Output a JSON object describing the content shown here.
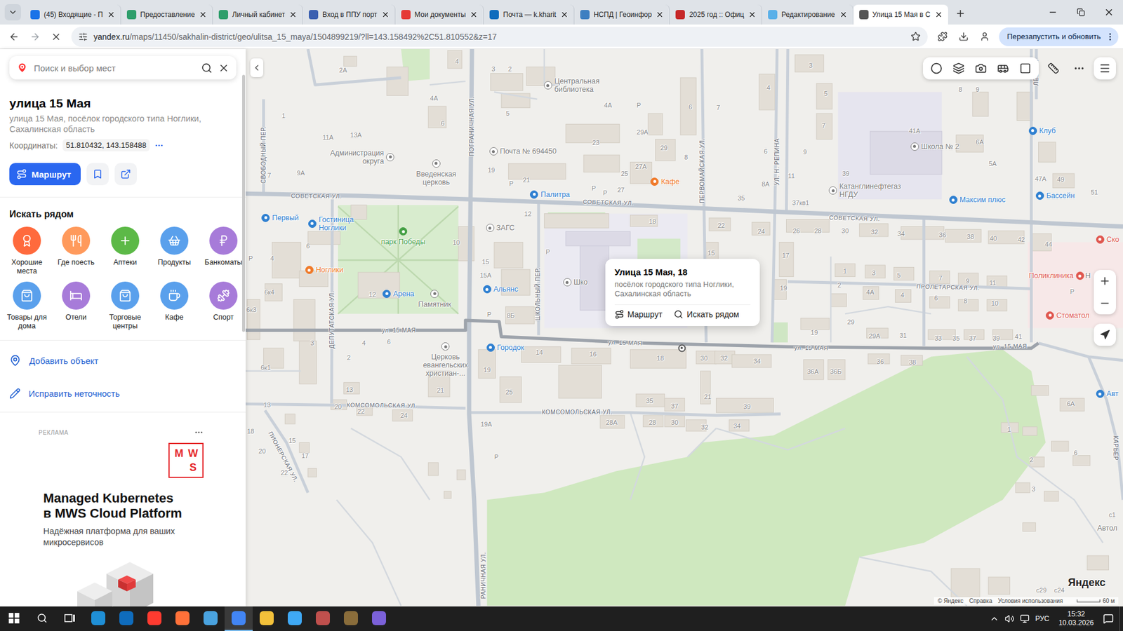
{
  "browser": {
    "tabs": [
      {
        "label": "(45) Входящие - П",
        "selected": false,
        "color": "#1a73e8"
      },
      {
        "label": "Предоставление",
        "selected": false,
        "color": "#2e9e6b"
      },
      {
        "label": "Личный кабинет",
        "selected": false,
        "color": "#2e9e6b"
      },
      {
        "label": "Вход в ППУ порт",
        "selected": false,
        "color": "#3a5fb0"
      },
      {
        "label": "Мои документы",
        "selected": false,
        "color": "#e53935"
      },
      {
        "label": "Почта — k.kharit",
        "selected": false,
        "color": "#0f6cbd"
      },
      {
        "label": "НСПД | Геоинфор",
        "selected": false,
        "color": "#3d7fc1"
      },
      {
        "label": "2025 год :: Офиц",
        "selected": false,
        "color": "#c62828"
      },
      {
        "label": "Редактирование",
        "selected": false,
        "color": "#5ab0e8"
      },
      {
        "label": "Улица 15 Мая в С",
        "selected": true,
        "color": "#555555"
      }
    ],
    "address": {
      "host": "yandex.ru",
      "path": "/maps/11450/sakhalin-district/geo/ulitsa_15_maya/1504899219/?ll=143.158492%2C51.810552&z=17",
      "bookmarked": false
    },
    "loading": true,
    "update_button": "Перезапустить и обновить"
  },
  "sidebar": {
    "search_placeholder": "Поиск и выбор мест",
    "title": "улица 15 Мая",
    "address": "улица 15 Мая, посёлок городского типа Ноглики, Сахалинская область",
    "coordinates_label": "Координаты:",
    "coordinates": "51.810432, 143.158488",
    "route_button": "Маршрут",
    "nearby_title": "Искать рядом",
    "categories": [
      {
        "label": "Хорошие места",
        "color": "#ff6a3d"
      },
      {
        "label": "Где поесть",
        "color": "#ff9a5c"
      },
      {
        "label": "Аптеки",
        "color": "#5cb947"
      },
      {
        "label": "Продукты",
        "color": "#5aa0ec"
      },
      {
        "label": "Банкоматы",
        "color": "#a77bd9"
      },
      {
        "label": "Товары для дома",
        "color": "#5aa0ec"
      },
      {
        "label": "Отели",
        "color": "#a77bd9"
      },
      {
        "label": "Торговые центры",
        "color": "#5aa0ec"
      },
      {
        "label": "Кафе",
        "color": "#5aa0ec"
      },
      {
        "label": "Спорт",
        "color": "#a77bd9"
      }
    ],
    "actions": [
      {
        "label": "Добавить объект"
      },
      {
        "label": "Исправить неточность"
      }
    ],
    "ad": {
      "badge": "РЕКЛАМА",
      "logo": [
        "M",
        "W",
        "S"
      ],
      "headline": [
        "Managed Kubernetes",
        "в MWS Cloud Platform"
      ],
      "text": [
        "Надёжная платформа для ваших",
        "микросервисов"
      ]
    }
  },
  "map": {
    "streets": [
      "СОВЕТСКАЯ УЛ.",
      "СОВЕТСКАЯ УЛ.",
      "СОВЕТСКАЯ УЛ.",
      "ул. 15 МАЯ",
      "ул. 15 МАЯ",
      "ул. 15 МАЯ",
      "ул. 15 МАЯ",
      "КОМСОМОЛЬСКАЯ УЛ.",
      "КОМСОМОЛЬСКАЯ УЛ.",
      "ПРОЛЕТАРСКАЯ УЛ.",
      "ПОГРАНИЧНАЯ УЛ.",
      "ПЕРВОМАЙСКАЯ УЛ.",
      "УЛ. Н. РЕПИНА",
      "ДЕПУТАТСКАЯ УЛ.",
      "ШКОЛЬНЫЙ ПЕР.",
      "СВОБОДНЫЙ ПЕР.",
      "ПИОНЕРСКАЯ УЛ.",
      "ЛЕСНАЯ",
      "КАРЬЕР",
      "РАНИЧНАЯ УЛ."
    ],
    "pois": [
      {
        "label": "Центральная библиотека",
        "color": "#7a7a7a",
        "kind": "outline"
      },
      {
        "label": "Администрация округа",
        "color": "#7a7a7a",
        "kind": "outline"
      },
      {
        "label": "Почта № 694450",
        "color": "#7a7a7a",
        "kind": "outline"
      },
      {
        "label": "Введенская церковь",
        "color": "#7a7a7a",
        "kind": "outline"
      },
      {
        "label": "Палитра",
        "color": "#2f80d1",
        "kind": "filled"
      },
      {
        "label": "Кафе",
        "color": "#f07a2a",
        "kind": "filled"
      },
      {
        "label": "Школа № 2",
        "color": "#7a7a7a",
        "kind": "outline"
      },
      {
        "label": "Клуб",
        "color": "#2f80d1",
        "kind": "filled"
      },
      {
        "label": "Катанглинефтегаз НГДУ",
        "color": "#7a7a7a",
        "kind": "outline"
      },
      {
        "label": "Максим плюс",
        "color": "#2f80d1",
        "kind": "filled"
      },
      {
        "label": "Бассейн",
        "color": "#2f80d1",
        "kind": "filled"
      },
      {
        "label": "Первый",
        "color": "#2f80d1",
        "kind": "filled"
      },
      {
        "label": "Гостиница Ноглики",
        "color": "#2f80d1",
        "kind": "filled"
      },
      {
        "label": "парк Победы",
        "color": "#45a045",
        "kind": "filled"
      },
      {
        "label": "ЗАГС",
        "color": "#7a7a7a",
        "kind": "outline"
      },
      {
        "label": "Ноглики",
        "color": "#f07a2a",
        "kind": "filled"
      },
      {
        "label": "Арена",
        "color": "#2f80d1",
        "kind": "filled"
      },
      {
        "label": "Памятник",
        "color": "#7a7a7a",
        "kind": "outline"
      },
      {
        "label": "Альянс",
        "color": "#2f80d1",
        "kind": "filled"
      },
      {
        "label": "Городок",
        "color": "#2f80d1",
        "kind": "filled"
      },
      {
        "label": "Церковь евангельских христиан-...",
        "color": "#7a7a7a",
        "kind": "outline"
      },
      {
        "label": "Шко",
        "color": "#7a7a7a",
        "kind": "outline"
      },
      {
        "label": "Поликлиника",
        "color": "#e0574f",
        "kind": "filled"
      },
      {
        "label": "Стоматол",
        "color": "#e0574f",
        "kind": "filled"
      },
      {
        "label": "Ско",
        "color": "#e0574f",
        "kind": "filled"
      },
      {
        "label": "Авт",
        "color": "#2f80d1",
        "kind": "filled"
      }
    ],
    "labels": [
      "Н",
      "Автол"
    ],
    "numbers": [
      "2А",
      "4",
      "3",
      "2",
      "4А",
      "6",
      "5",
      "4А",
      "6",
      "7",
      "3",
      "4",
      "5",
      "7",
      "8",
      "9",
      "41А",
      "6А",
      "5А",
      "47А",
      "49",
      "51",
      "1",
      "11А",
      "13А",
      "7",
      "9А",
      "19",
      "21",
      "23",
      "29",
      "29А",
      "25",
      "27А",
      "27",
      "8",
      "6",
      "9",
      "8А",
      "11",
      "39",
      "35",
      "37кв1",
      "12",
      "18",
      "22",
      "24",
      "26",
      "28",
      "30",
      "32",
      "34",
      "36",
      "38",
      "40",
      "42",
      "44",
      "10",
      "15",
      "15А",
      "8Б",
      "15",
      "17",
      "19",
      "1",
      "3",
      "5",
      "2",
      "4А",
      "4",
      "7",
      "9",
      "11",
      "6",
      "8",
      "10",
      "29",
      "19",
      "29А",
      "31",
      "33",
      "35",
      "37",
      "39",
      "41",
      "6к4",
      "4",
      "6",
      "12",
      "3",
      "2",
      "4",
      "6",
      "14",
      "16",
      "18",
      "30",
      "32",
      "34",
      "36А",
      "36Б",
      "36",
      "38",
      "19",
      "21",
      "25",
      "13",
      "20",
      "22",
      "24",
      "13",
      "15",
      "17",
      "18",
      "20",
      "22",
      "35",
      "37",
      "21",
      "39",
      "28А",
      "28",
      "30",
      "32",
      "34",
      "19А",
      "6к1",
      "6к3",
      "6А",
      "1",
      "2",
      "6",
      "3",
      "с1",
      "с29",
      "с24",
      "P",
      "P",
      "P",
      "P",
      "P",
      "P",
      "P",
      "P",
      "P"
    ],
    "popup": {
      "title": "Улица 15 Мая, 18",
      "subtitle": "посёлок городского типа Ноглики, Сахалинская область",
      "buttons": [
        "Маршрут",
        "Искать рядом"
      ]
    },
    "logo": "Яндекс",
    "footer": [
      "© Яндекс",
      "Справка",
      "Условия использования"
    ],
    "scale": "60 м"
  },
  "taskbar": {
    "apps": [
      {
        "color": "#1f8fd6",
        "selected": false
      },
      {
        "color": "#0f6cbd",
        "selected": false
      },
      {
        "color": "#ff3b30",
        "selected": false
      },
      {
        "color": "#ff7139",
        "selected": false
      },
      {
        "color": "#4aa3df",
        "selected": false
      },
      {
        "color": "#4285f4",
        "selected": true
      },
      {
        "color": "#f3c13a",
        "selected": false
      },
      {
        "color": "#3fa9f5",
        "selected": false
      },
      {
        "color": "#c0504d",
        "selected": false
      },
      {
        "color": "#8a6d3b",
        "selected": false
      },
      {
        "color": "#7b61d9",
        "selected": false
      }
    ],
    "language": "РУС",
    "time": "15:32",
    "date": "10.03.2026"
  }
}
